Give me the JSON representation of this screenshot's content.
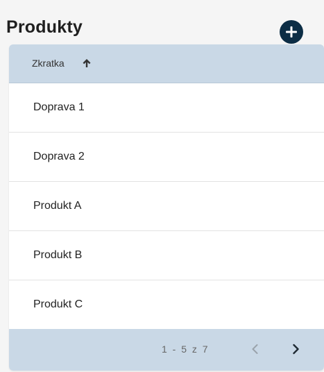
{
  "header": {
    "title": "Produkty",
    "add_icon": "plus-circle-icon"
  },
  "table": {
    "column_header": "Zkratka",
    "sort_icon": "arrow-up-icon",
    "rows": [
      {
        "label": "Doprava 1"
      },
      {
        "label": "Doprava 2"
      },
      {
        "label": "Produkt A"
      },
      {
        "label": "Produkt B"
      },
      {
        "label": "Produkt C"
      }
    ]
  },
  "pagination": {
    "range_text": "1 - 5 z 7",
    "prev_icon": "chevron-left-icon",
    "next_icon": "chevron-right-icon",
    "prev_enabled": false,
    "next_enabled": true
  },
  "colors": {
    "header_bg": "#c9d8e6",
    "accent_dark": "#0c2d45",
    "page_bg": "#f5f5f5"
  }
}
